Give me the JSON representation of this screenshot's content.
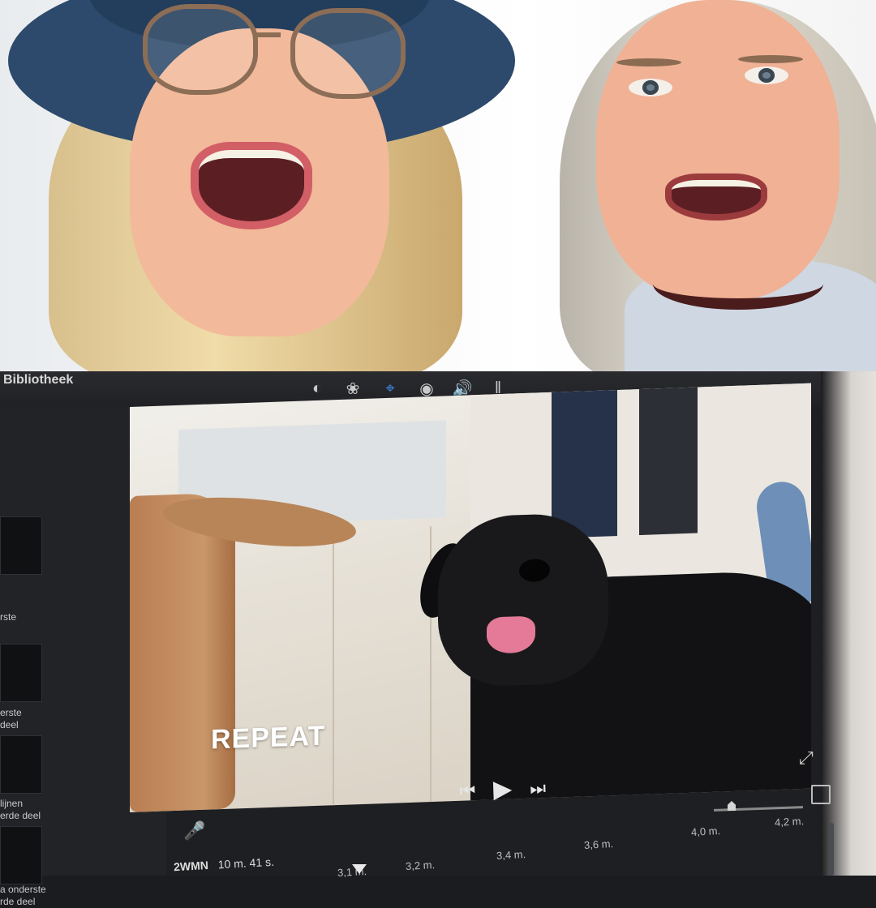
{
  "library": {
    "label": "Bibliotheek"
  },
  "toolbar": {
    "tools": [
      "color-balance-icon",
      "color-palette-icon",
      "crop-icon",
      "camera-icon",
      "volume-icon",
      "equalizer-icon"
    ],
    "active_tool": "crop-icon",
    "accent_color": "#3f8be8"
  },
  "sidebar": {
    "items": [
      {
        "label": "rste"
      },
      {
        "label": "erste\ndeel"
      },
      {
        "label": "lijnen\nerde deel"
      },
      {
        "label": "a onderste\nrde deel"
      }
    ]
  },
  "viewer": {
    "title_text": "REPEAT"
  },
  "timeline": {
    "project_name": "2WMN",
    "duration": "10 m. 41 s.",
    "ticks": [
      "3,1 m.",
      "3,2 m.",
      "3,4 m.",
      "3,6 m.",
      "4,0 m.",
      "4,2 m."
    ]
  }
}
